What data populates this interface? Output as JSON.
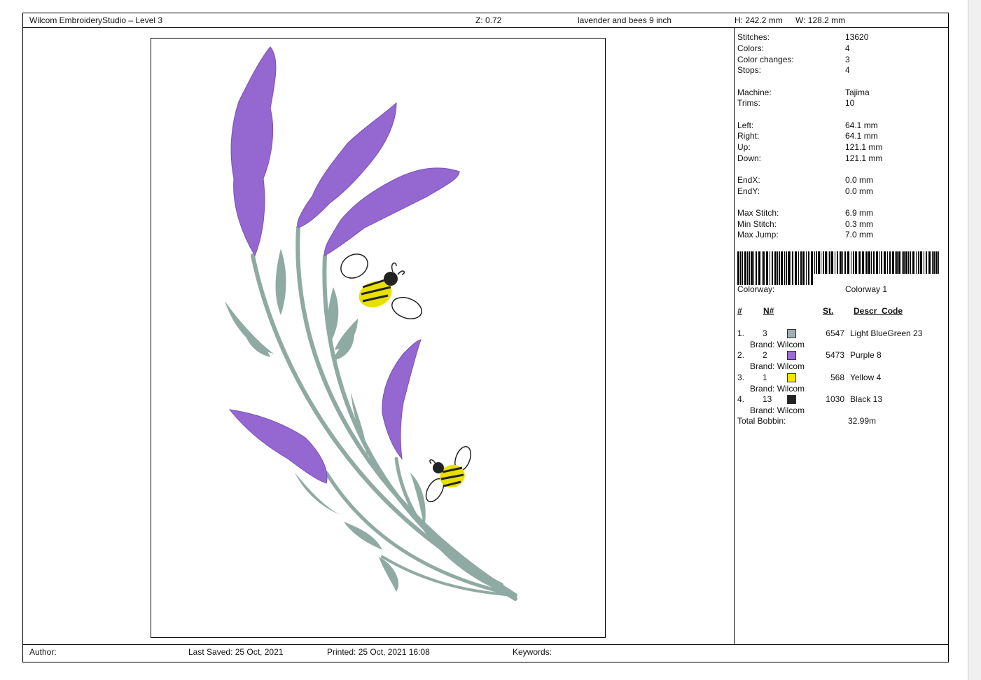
{
  "header": {
    "app_title": "Wilcom EmbroideryStudio – Level 3",
    "zoom": "Z: 0.72",
    "design_name": "lavender and bees 9 inch",
    "height": "H: 242.2 mm",
    "width": "W: 128.2 mm"
  },
  "stats": [
    {
      "label": "Stitches:",
      "value": "13620"
    },
    {
      "label": "Colors:",
      "value": "4"
    },
    {
      "label": "Color changes:",
      "value": "3"
    },
    {
      "label": "Stops:",
      "value": "4"
    },
    {
      "label": "Machine:",
      "value": "Tajima"
    },
    {
      "label": "Trims:",
      "value": "10"
    },
    {
      "label": "Left:",
      "value": "64.1 mm"
    },
    {
      "label": "Right:",
      "value": "64.1 mm"
    },
    {
      "label": "Up:",
      "value": "121.1 mm"
    },
    {
      "label": "Down:",
      "value": "121.1 mm"
    },
    {
      "label": "EndX:",
      "value": "0.0 mm"
    },
    {
      "label": "EndY:",
      "value": "0.0 mm"
    },
    {
      "label": "Max Stitch:",
      "value": "6.9 mm"
    },
    {
      "label": "Min Stitch:",
      "value": "0.3 mm"
    },
    {
      "label": "Max Jump:",
      "value": "7.0 mm"
    }
  ],
  "colorway": {
    "label": "Colorway:",
    "value": "Colorway 1"
  },
  "table": {
    "col_index": "#",
    "col_n": "N#",
    "col_st": "St.",
    "col_descr": "Descr_Code",
    "rows": [
      {
        "idx": "1.",
        "n": "3",
        "color": "#9fb0b4",
        "st": "6547",
        "descr": "Light BlueGreen 23",
        "brand": "Brand: Wilcom"
      },
      {
        "idx": "2.",
        "n": "2",
        "color": "#9a6cd8",
        "st": "5473",
        "descr": "Purple 8",
        "brand": "Brand: Wilcom"
      },
      {
        "idx": "3.",
        "n": "1",
        "color": "#f4e400",
        "st": "568",
        "descr": "Yellow 4",
        "brand": "Brand: Wilcom"
      },
      {
        "idx": "4.",
        "n": "13",
        "color": "#222222",
        "st": "1030",
        "descr": "Black 13",
        "brand": "Brand: Wilcom"
      }
    ],
    "total_label": "Total Bobbin:",
    "total_value": "32.99m"
  },
  "footer": {
    "author": "Author:",
    "last_saved": "Last Saved: 25 Oct, 2021",
    "printed": "Printed: 25 Oct, 2021 16:08",
    "keywords": "Keywords:"
  },
  "design_colors": {
    "stem": "#8faaa2",
    "lavender": "#9468d0",
    "lavender_dark": "#7a50b8",
    "bee_yellow": "#e8e000",
    "bee_black": "#222222"
  }
}
